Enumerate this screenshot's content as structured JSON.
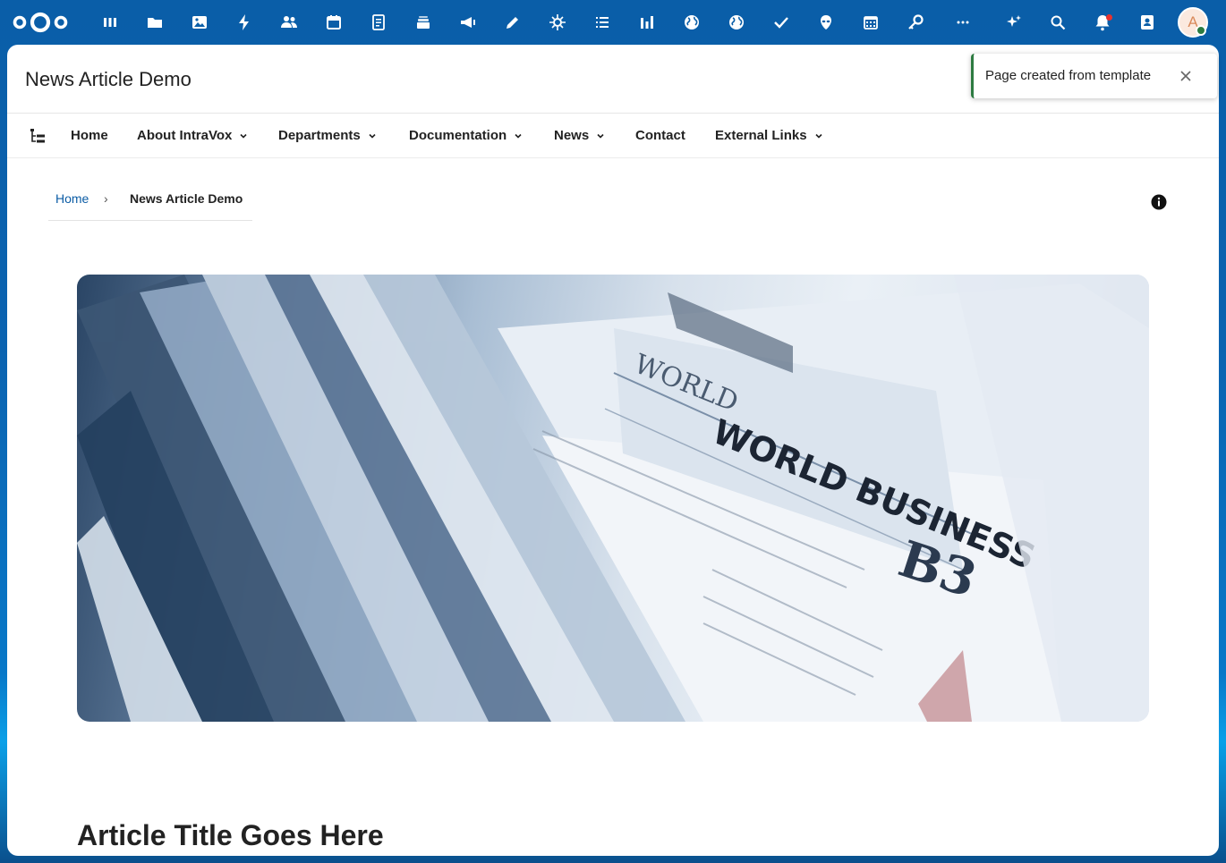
{
  "colors": {
    "header_bg": "#0a5ea8",
    "accent_link": "#0b5ca5",
    "success": "#2d7b41",
    "notification": "#e9322d",
    "text": "#222222"
  },
  "header": {
    "logo": "nextcloud-logo",
    "apps": [
      {
        "name": "dashboard-icon"
      },
      {
        "name": "files-icon"
      },
      {
        "name": "photos-icon"
      },
      {
        "name": "activity-icon"
      },
      {
        "name": "contacts-people-icon"
      },
      {
        "name": "calendar-icon"
      },
      {
        "name": "notes-icon"
      },
      {
        "name": "deck-icon"
      },
      {
        "name": "announcements-icon"
      },
      {
        "name": "pencil-icon"
      },
      {
        "name": "sparkle-app-icon"
      },
      {
        "name": "tasks-list-icon"
      },
      {
        "name": "analytics-icon"
      },
      {
        "name": "globe-icon-1"
      },
      {
        "name": "globe-icon-2"
      },
      {
        "name": "checkmark-icon"
      },
      {
        "name": "alien-icon"
      },
      {
        "name": "calendar-grid-icon"
      },
      {
        "name": "key-icon"
      },
      {
        "name": "more-apps-icon"
      }
    ],
    "right_icons": [
      "assistant-icon",
      "search-icon",
      "notifications-icon",
      "contacts-menu-icon"
    ],
    "avatar_initial": "A"
  },
  "page": {
    "title": "News Article Demo"
  },
  "nav": {
    "items": [
      {
        "label": "Home",
        "has_dropdown": false
      },
      {
        "label": "About IntraVox",
        "has_dropdown": true
      },
      {
        "label": "Departments",
        "has_dropdown": true
      },
      {
        "label": "Documentation",
        "has_dropdown": true
      },
      {
        "label": "News",
        "has_dropdown": true
      },
      {
        "label": "Contact",
        "has_dropdown": false
      },
      {
        "label": "External Links",
        "has_dropdown": true
      }
    ]
  },
  "breadcrumb": {
    "home": "Home",
    "separator": "›",
    "current": "News Article Demo"
  },
  "hero": {
    "headline": "WORLD BUSINESS",
    "section": "B3"
  },
  "article": {
    "title": "Article Title Goes Here"
  },
  "toast": {
    "message": "Page created from template"
  }
}
